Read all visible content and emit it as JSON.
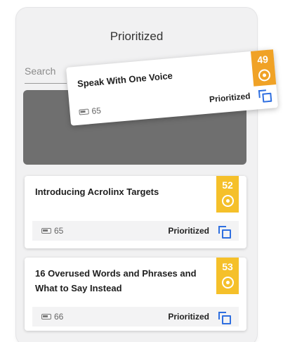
{
  "panel": {
    "title": "Prioritized",
    "search_placeholder": "Search"
  },
  "dragged_card": {
    "title": "Speak With One Voice",
    "score": "49",
    "meta_count": "65",
    "status": "Prioritized",
    "score_color": "#f0a226"
  },
  "cards": [
    {
      "title": "Introducing Acrolinx Targets",
      "score": "52",
      "meta_count": "65",
      "status": "Prioritized"
    },
    {
      "title_line1": "16 Overused Words and Phrases and",
      "title_line2": "What to Say Instead",
      "score": "53",
      "meta_count": "66",
      "status": "Prioritized"
    }
  ],
  "colors": {
    "score_badge": "#f5c02a",
    "accent_blue": "#2f6fe0",
    "drop_zone": "#6f6f6f"
  },
  "icons": {
    "meta": "document-count-icon",
    "score": "target-icon",
    "copy": "copy-icon"
  }
}
